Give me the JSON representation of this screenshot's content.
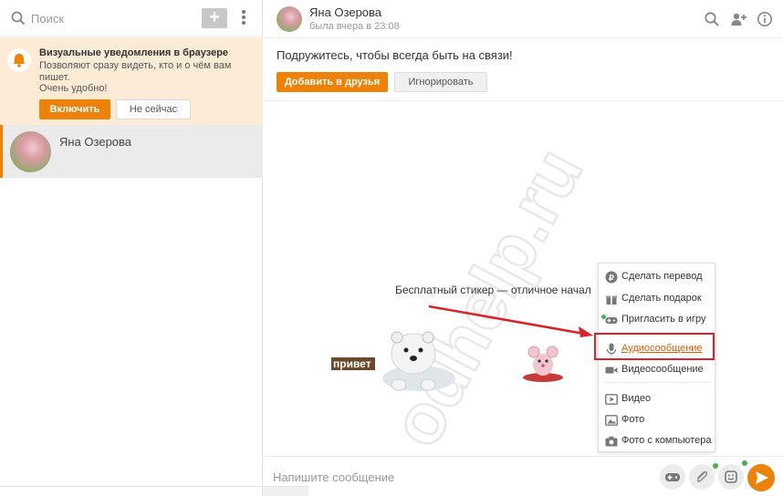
{
  "sidebar": {
    "search_placeholder": "Поиск",
    "add_label": "+",
    "notification": {
      "title": "Визуальные уведомления в браузере",
      "text": "Позволяют сразу видеть, кто и о чём вам пишет.",
      "text2": "Очень удобно!",
      "enable_label": "Включить",
      "not_now_label": "Не сейчас"
    },
    "chats": [
      {
        "name": "Яна Озерова"
      }
    ]
  },
  "header": {
    "name": "Яна Озерова",
    "status": "была вчера в 23:08",
    "icons": [
      "search-icon",
      "add-friend-icon",
      "info-icon"
    ]
  },
  "friend_prompt": {
    "text": "Подружитесь, чтобы всегда быть на связи!",
    "add_label": "Добавить в друзья",
    "ignore_label": "Игнорировать"
  },
  "messages": {
    "sticker_caption": "Бесплатный стикер — отличное начал",
    "sticker_text": "привет",
    "watermark": "odhelp.ru"
  },
  "attach_menu": {
    "items": [
      {
        "label": "Сделать перевод",
        "icon": "ruble-icon"
      },
      {
        "label": "Сделать подарок",
        "icon": "gift-icon"
      },
      {
        "label": "Пригласить в игру",
        "icon": "gamepad-icon"
      },
      {
        "label": "Аудиосообщение",
        "icon": "microphone-icon"
      },
      {
        "label": "Видеосообщение",
        "icon": "video-camera-icon"
      },
      {
        "label": "Видео",
        "icon": "video-play-icon"
      },
      {
        "label": "Фото",
        "icon": "image-icon"
      },
      {
        "label": "Фото с компьютера",
        "icon": "camera-icon"
      }
    ]
  },
  "composer": {
    "placeholder": "Напишите сообщение",
    "buttons": [
      "gamepad-icon",
      "paperclip-icon",
      "smiley-icon",
      "send-icon"
    ]
  },
  "colors": {
    "accent": "#ee8208",
    "notification_bg": "#fdebd6",
    "highlight": "#d8232a"
  }
}
